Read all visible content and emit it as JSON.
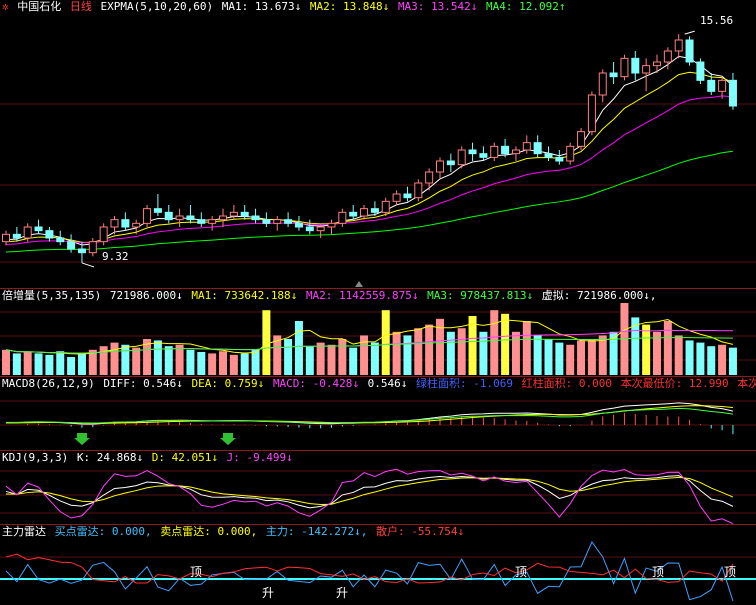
{
  "main": {
    "stock_name": "中国石化",
    "period": "日线",
    "indicator": "EXPMA(5,10,20,60)",
    "ma1": "MA1: 13.673↓",
    "ma2": "MA2: 13.848↓",
    "ma3": "MA3: 13.542↓",
    "ma4": "MA4: 12.092↑",
    "high_label": "15.56",
    "low_label": "9.32",
    "colors": {
      "ma1": "#ffffff",
      "ma2": "#ffff00",
      "ma3": "#ff00ff",
      "ma4": "#00ff00",
      "up": "#ff8080",
      "down": "#80ffff"
    }
  },
  "volume": {
    "indicator": "倍增量(5,35,135)",
    "value": "721986.000↓",
    "ma1": "MA1: 733642.188↓",
    "ma2": "MA2: 1142559.875↓",
    "ma3": "MA3: 978437.813↓",
    "virtual": "虚拟: 721986.000↓,"
  },
  "macd": {
    "indicator": "MACD8(26,12,9)",
    "diff": "DIFF: 0.546↓",
    "dea": "DEA: 0.759↓",
    "macd": "MACD: -0.428↓",
    "macd2": "0.546↓",
    "green_area": "绿柱面积: -1.069",
    "red_area": "红柱面积: 0.000",
    "lowest": "本次最低价: 12.990",
    "tail": "本次"
  },
  "kdj": {
    "indicator": "KDJ(9,3,3)",
    "k": "K: 24.868↓",
    "d": "D: 42.051↓",
    "j": "J: -9.499↓"
  },
  "radar": {
    "indicator": "主力雷达",
    "buy": "买点雷达: 0.000,",
    "sell": "卖点雷达: 0.000,",
    "main_force": "主力: -142.272↓,",
    "retail": "散户: -55.754↓",
    "top_label": "顶",
    "rise_label": "升"
  },
  "chart_data": {
    "type": "candlestick",
    "ylim_price": [
      8.8,
      16.0
    ],
    "candles": [
      [
        9.9,
        10.2,
        9.8,
        10.1
      ],
      [
        10.1,
        10.3,
        9.9,
        10.0
      ],
      [
        10.0,
        10.4,
        9.9,
        10.3
      ],
      [
        10.3,
        10.5,
        10.1,
        10.2
      ],
      [
        10.2,
        10.3,
        9.9,
        10.0
      ],
      [
        10.0,
        10.2,
        9.8,
        9.9
      ],
      [
        9.9,
        10.1,
        9.6,
        9.7
      ],
      [
        9.7,
        9.9,
        9.32,
        9.6
      ],
      [
        9.6,
        10.0,
        9.5,
        9.9
      ],
      [
        9.9,
        10.4,
        9.8,
        10.3
      ],
      [
        10.3,
        10.6,
        10.1,
        10.5
      ],
      [
        10.5,
        10.7,
        10.2,
        10.3
      ],
      [
        10.3,
        10.5,
        10.1,
        10.4
      ],
      [
        10.4,
        10.9,
        10.3,
        10.8
      ],
      [
        10.8,
        11.2,
        10.6,
        10.7
      ],
      [
        10.7,
        10.9,
        10.4,
        10.5
      ],
      [
        10.5,
        10.8,
        10.3,
        10.6
      ],
      [
        10.6,
        10.9,
        10.4,
        10.5
      ],
      [
        10.5,
        10.7,
        10.3,
        10.4
      ],
      [
        10.4,
        10.6,
        10.2,
        10.5
      ],
      [
        10.5,
        10.8,
        10.3,
        10.6
      ],
      [
        10.6,
        10.9,
        10.5,
        10.7
      ],
      [
        10.7,
        10.9,
        10.5,
        10.6
      ],
      [
        10.6,
        10.8,
        10.4,
        10.5
      ],
      [
        10.5,
        10.7,
        10.3,
        10.4
      ],
      [
        10.4,
        10.6,
        10.2,
        10.5
      ],
      [
        10.5,
        10.7,
        10.3,
        10.4
      ],
      [
        10.4,
        10.6,
        10.2,
        10.3
      ],
      [
        10.3,
        10.5,
        10.1,
        10.2
      ],
      [
        10.2,
        10.4,
        10.0,
        10.3
      ],
      [
        10.3,
        10.5,
        10.1,
        10.4
      ],
      [
        10.4,
        10.8,
        10.3,
        10.7
      ],
      [
        10.7,
        10.9,
        10.5,
        10.6
      ],
      [
        10.6,
        10.9,
        10.5,
        10.8
      ],
      [
        10.8,
        11.0,
        10.6,
        10.7
      ],
      [
        10.7,
        11.1,
        10.6,
        11.0
      ],
      [
        11.0,
        11.3,
        10.9,
        11.2
      ],
      [
        11.2,
        11.4,
        11.0,
        11.1
      ],
      [
        11.1,
        11.6,
        11.0,
        11.5
      ],
      [
        11.5,
        11.9,
        11.3,
        11.8
      ],
      [
        11.8,
        12.2,
        11.6,
        12.1
      ],
      [
        12.1,
        12.3,
        11.8,
        12.0
      ],
      [
        12.0,
        12.5,
        11.9,
        12.4
      ],
      [
        12.4,
        12.6,
        12.1,
        12.3
      ],
      [
        12.3,
        12.5,
        12.1,
        12.2
      ],
      [
        12.2,
        12.6,
        12.1,
        12.5
      ],
      [
        12.5,
        12.7,
        12.2,
        12.3
      ],
      [
        12.3,
        12.5,
        12.1,
        12.4
      ],
      [
        12.4,
        12.8,
        12.3,
        12.6
      ],
      [
        12.6,
        12.8,
        12.2,
        12.3
      ],
      [
        12.3,
        12.5,
        12.1,
        12.2
      ],
      [
        12.2,
        12.4,
        12.0,
        12.1
      ],
      [
        12.1,
        12.6,
        12.0,
        12.5
      ],
      [
        12.5,
        13.0,
        12.4,
        12.9
      ],
      [
        12.9,
        14.0,
        12.8,
        13.9
      ],
      [
        13.9,
        14.6,
        13.7,
        14.5
      ],
      [
        14.5,
        14.8,
        14.2,
        14.4
      ],
      [
        14.4,
        15.0,
        14.3,
        14.9
      ],
      [
        14.9,
        15.1,
        14.3,
        14.5
      ],
      [
        14.5,
        14.9,
        14.0,
        14.7
      ],
      [
        14.7,
        15.0,
        14.5,
        14.8
      ],
      [
        14.8,
        15.2,
        14.6,
        15.1
      ],
      [
        15.1,
        15.56,
        14.9,
        15.4
      ],
      [
        15.4,
        15.5,
        14.7,
        14.8
      ],
      [
        14.8,
        14.9,
        14.2,
        14.3
      ],
      [
        14.3,
        14.5,
        13.9,
        14.0
      ],
      [
        14.0,
        14.4,
        13.8,
        14.3
      ],
      [
        14.3,
        14.5,
        13.5,
        13.6
      ]
    ]
  }
}
